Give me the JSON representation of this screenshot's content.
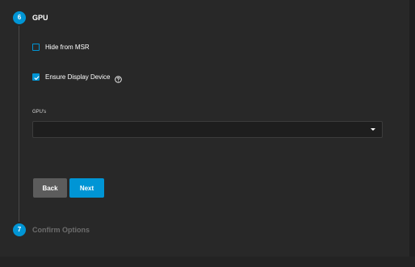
{
  "colors": {
    "accent": "#0095d5",
    "background": "#282828",
    "select_background": "#1e1e1e",
    "back_button": "#5c5c5c",
    "muted_text": "#6d6d6d"
  },
  "steps": [
    {
      "number": "6",
      "title": "GPU",
      "state": "active"
    },
    {
      "number": "7",
      "title": "Confirm Options",
      "state": "inactive"
    }
  ],
  "options": {
    "hide_from_msr": {
      "label": "Hide from MSR",
      "checked": false
    },
    "ensure_display_device": {
      "label": "Ensure Display Device",
      "checked": true,
      "icon": "help-circle-icon"
    }
  },
  "gpus": {
    "label": "GPU's",
    "value": ""
  },
  "buttons": {
    "back": "Back",
    "next": "Next"
  }
}
